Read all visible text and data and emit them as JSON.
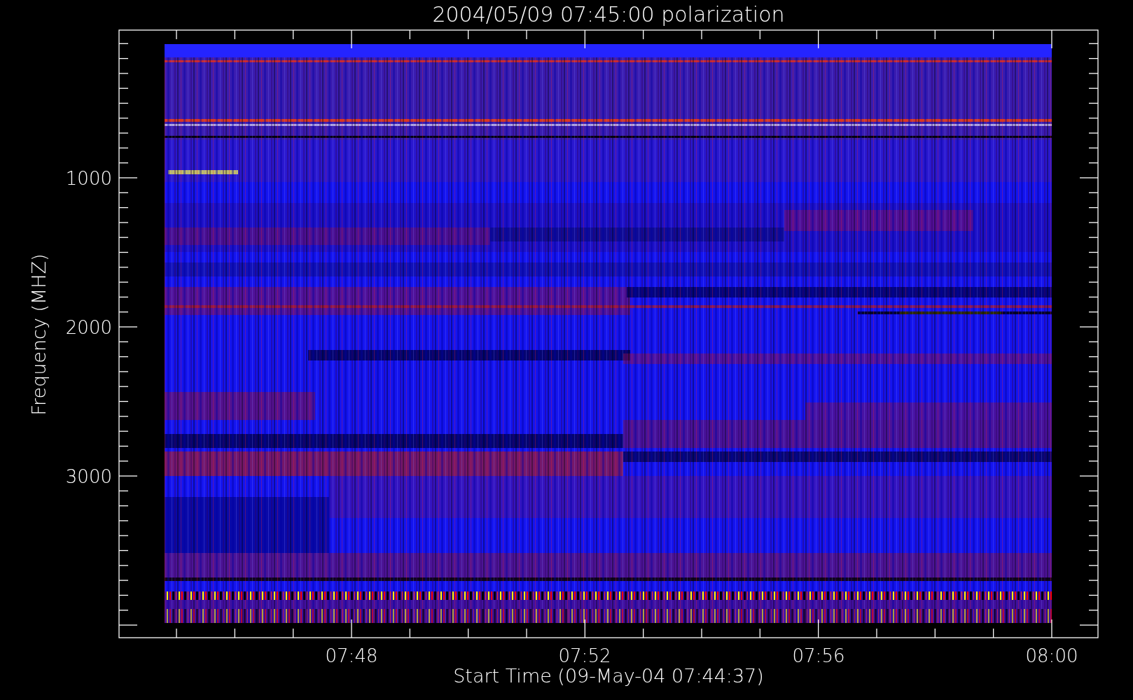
{
  "chart": {
    "title": "2004/05/09 07:45:00 polarization",
    "xlabel": "Start Time (09-May-04 07:44:37)",
    "ylabel": "Frequency (MHZ)",
    "xtick_labels": [
      "07:48",
      "07:52",
      "07:56",
      "08:00"
    ],
    "ytick_labels": [
      "1000",
      "2000",
      "3000"
    ]
  }
}
